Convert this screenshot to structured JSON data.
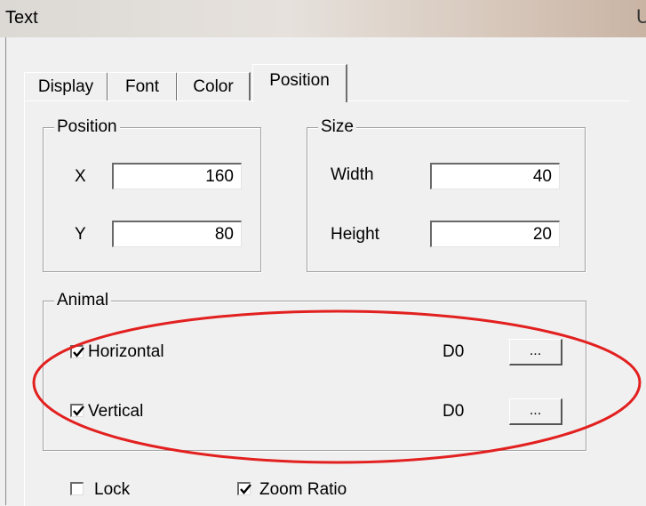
{
  "window": {
    "title": "Text",
    "title_edge_glyph": "U"
  },
  "tabs": [
    {
      "label": "Display",
      "active": false
    },
    {
      "label": "Font",
      "active": false
    },
    {
      "label": "Color",
      "active": false
    },
    {
      "label": "Position",
      "active": true
    }
  ],
  "position_group": {
    "legend": "Position",
    "x_label": "X",
    "x_value": "160",
    "y_label": "Y",
    "y_value": "80"
  },
  "size_group": {
    "legend": "Size",
    "width_label": "Width",
    "width_value": "40",
    "height_label": "Height",
    "height_value": "20"
  },
  "animal_group": {
    "legend": "Animal",
    "rows": [
      {
        "label": "Horizontal",
        "checked": true,
        "register": "D0",
        "button": "..."
      },
      {
        "label": "Vertical",
        "checked": true,
        "register": "D0",
        "button": "..."
      }
    ]
  },
  "options": [
    {
      "label": "Lock",
      "checked": false
    },
    {
      "label": "Zoom Ratio",
      "checked": true
    }
  ],
  "colors": {
    "highlight_ellipse": "#e2201f",
    "dialog_bg": "#f0f0f0"
  }
}
